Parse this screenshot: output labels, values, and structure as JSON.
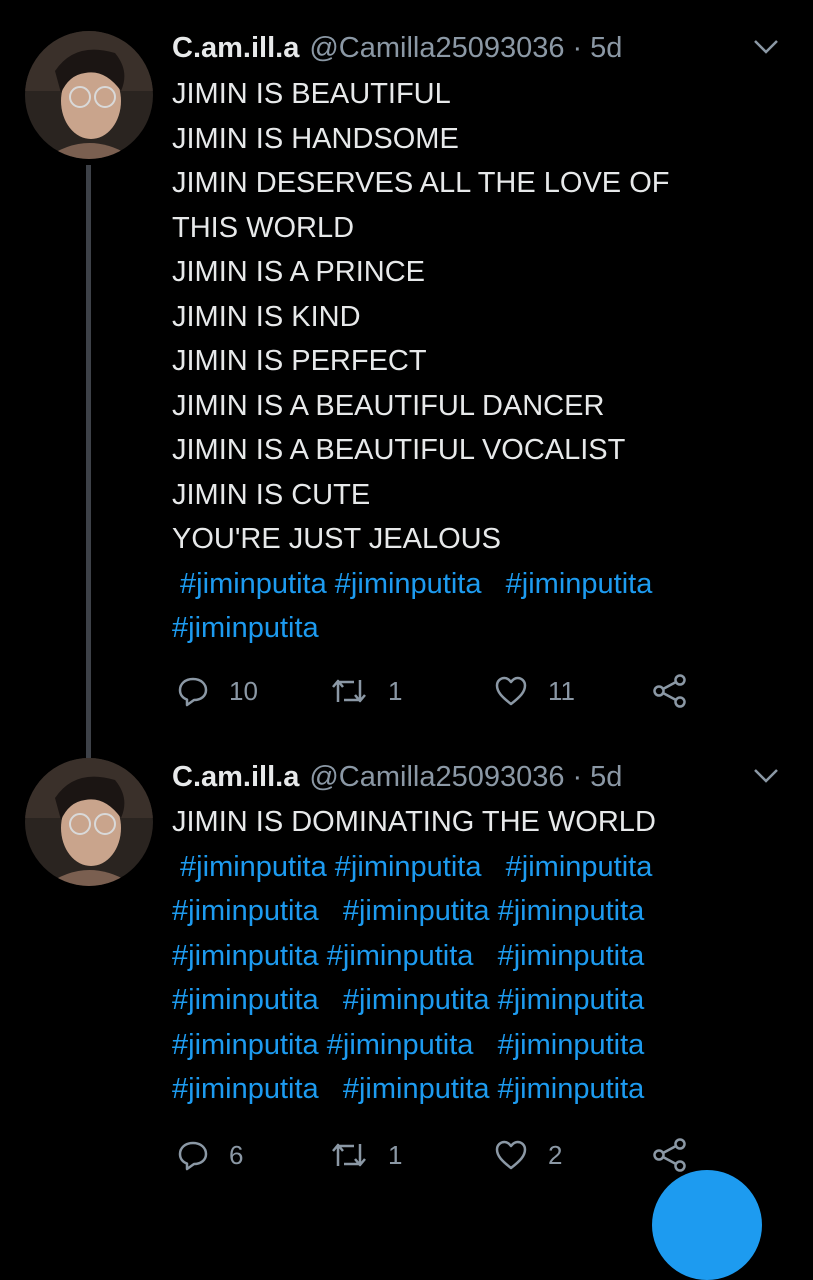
{
  "colors": {
    "background": "#000000",
    "text": "#e7e9ea",
    "muted": "#8b98a5",
    "hashtag": "#1d9bf0",
    "thread_line": "#3d4148"
  },
  "tweets": [
    {
      "author_name": "C.am.ill.a",
      "handle": "@Camilla25093036",
      "separator": "·",
      "time": "5d",
      "lines": [
        "JIMIN IS BEAUTIFUL",
        "JIMIN IS HANDSOME",
        "JIMIN DESERVES ALL THE LOVE OF",
        "THIS WORLD",
        "JIMIN IS A PRINCE",
        "JIMIN IS KIND",
        "JIMIN IS PERFECT",
        "JIMIN IS A BEAUTIFUL DANCER",
        "JIMIN IS A BEAUTIFUL VOCALIST",
        "JIMIN IS CUTE",
        "YOU'RE JUST JEALOUS"
      ],
      "hashtag_lines": [
        " #jiminputita #jiminputita   #jiminputita",
        "#jiminputita"
      ],
      "reply_count": "10",
      "retweet_count": "1",
      "like_count": "11"
    },
    {
      "author_name": "C.am.ill.a",
      "handle": "@Camilla25093036",
      "separator": "·",
      "time": "5d",
      "lines": [
        "JIMIN IS DOMINATING THE WORLD"
      ],
      "hashtag_lines": [
        " #jiminputita #jiminputita   #jiminputita",
        "#jiminputita   #jiminputita #jiminputita",
        "#jiminputita #jiminputita   #jiminputita",
        "#jiminputita   #jiminputita #jiminputita",
        "#jiminputita #jiminputita   #jiminputita",
        "#jiminputita   #jiminputita #jiminputita"
      ],
      "reply_count": "6",
      "retweet_count": "1",
      "like_count": "2"
    }
  ],
  "icons": {
    "reply": "reply-icon",
    "retweet": "retweet-icon",
    "like": "heart-icon",
    "share": "share-icon",
    "more": "chevron-down-icon",
    "compose": "compose-fab"
  }
}
